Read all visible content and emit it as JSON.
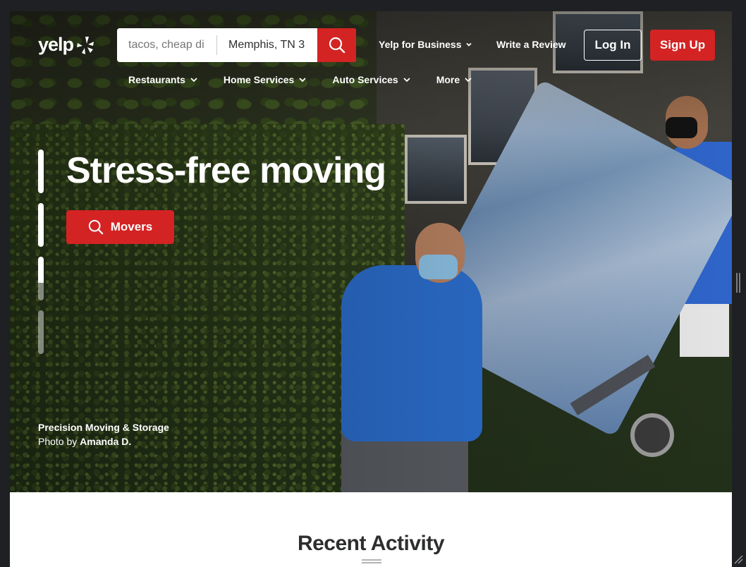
{
  "header": {
    "logo_text": "yelp",
    "search": {
      "find_placeholder": "tacos, cheap di",
      "near_value": "Memphis, TN 3"
    },
    "links": {
      "yelp_for_business": "Yelp for Business",
      "write_review": "Write a Review"
    },
    "login_label": "Log In",
    "signup_label": "Sign Up"
  },
  "nav": {
    "items": [
      {
        "label": "Restaurants"
      },
      {
        "label": "Home Services"
      },
      {
        "label": "Auto Services"
      },
      {
        "label": "More"
      }
    ]
  },
  "hero": {
    "title": "Stress-free moving",
    "cta_label": "Movers",
    "credit": {
      "business": "Precision Moving & Storage",
      "photo_by": "Photo by",
      "photographer": "Amanda D."
    },
    "carousel_slides": 4,
    "active_slide": 1
  },
  "main": {
    "section_title": "Recent Activity"
  },
  "colors": {
    "brand_red": "#d32323",
    "text_dark": "#2d2e2f"
  },
  "icons": [
    "yelp-burst-icon",
    "search-icon",
    "chevron-down-icon",
    "resize-handle-icon"
  ]
}
